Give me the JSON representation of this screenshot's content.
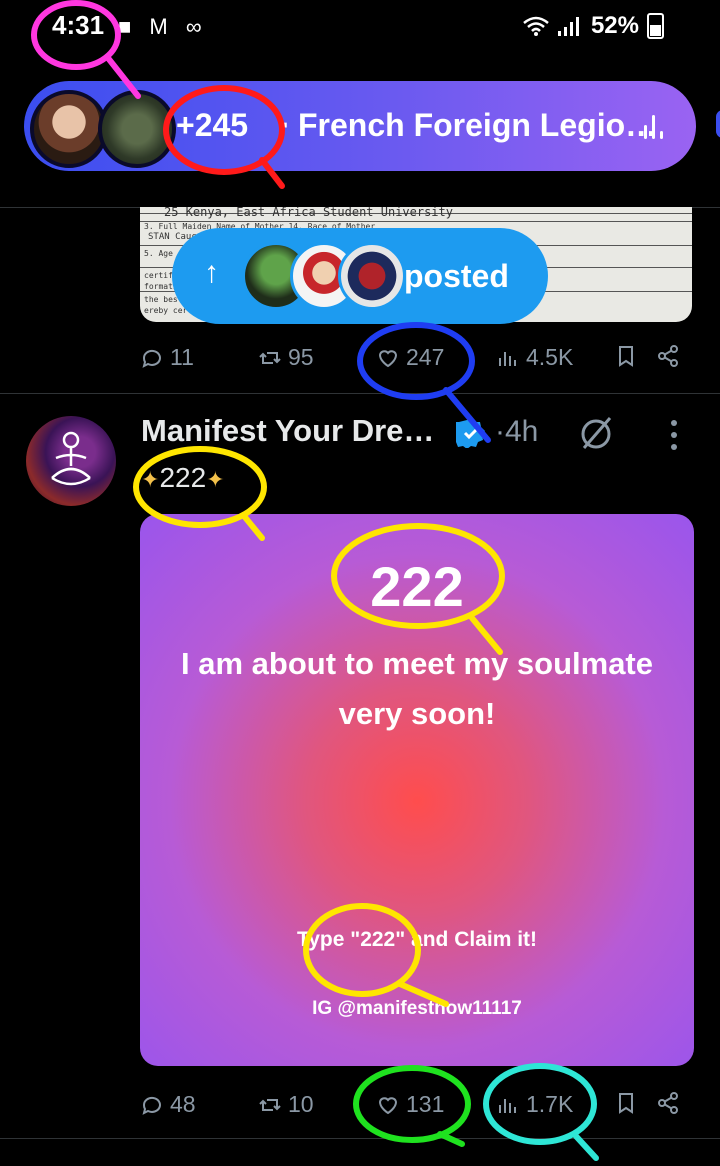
{
  "status_bar": {
    "time": "4:31",
    "left_icons": "■ M ∞",
    "signal": "▽↑ .∥",
    "battery": "52%"
  },
  "spaces_pill": {
    "count": "+245",
    "separator": "·",
    "title": "French Foreign Legio…"
  },
  "toast": {
    "arrow": "↑",
    "label": "posted"
  },
  "tweet1": {
    "replies": "11",
    "reposts": "95",
    "likes": "247",
    "views": "4.5K"
  },
  "tweet2": {
    "author": "Manifest Your Dre…",
    "dot": "·",
    "time": "4h",
    "text": "222",
    "card": {
      "number": "222",
      "line1": "I am about to meet my soulmate",
      "line2": "very soon!",
      "cta": "Type \"222\" and Claim it!",
      "ig": "IG @manifestnow11117"
    },
    "replies": "48",
    "reposts": "10",
    "likes": "131",
    "views": "1.7K"
  },
  "document_snippet": {
    "line_a": "25   Kenya, East Africa          Student                     University",
    "line_b": "3. Full Maiden Name of Mother                             14. Race of Mother",
    "line_c": "STAN                                                          Caucasian",
    "line_d": "5. Age                                          r Pregnancy  17b. Date Last Worked",
    "line_e": "certify                                   Parent  18b. Date of Signature",
    "line_f": "formation                                 Other   8-7-61",
    "line_g": "the best                                  M.D.   19b. Date of Signature",
    "line_h": "ereby certify                             D.O."
  },
  "colors": {
    "accent_blue": "#1d9bf0",
    "pill_start": "#3b4ef0",
    "pill_end": "#9a63f2",
    "muted": "#8b98a5"
  }
}
